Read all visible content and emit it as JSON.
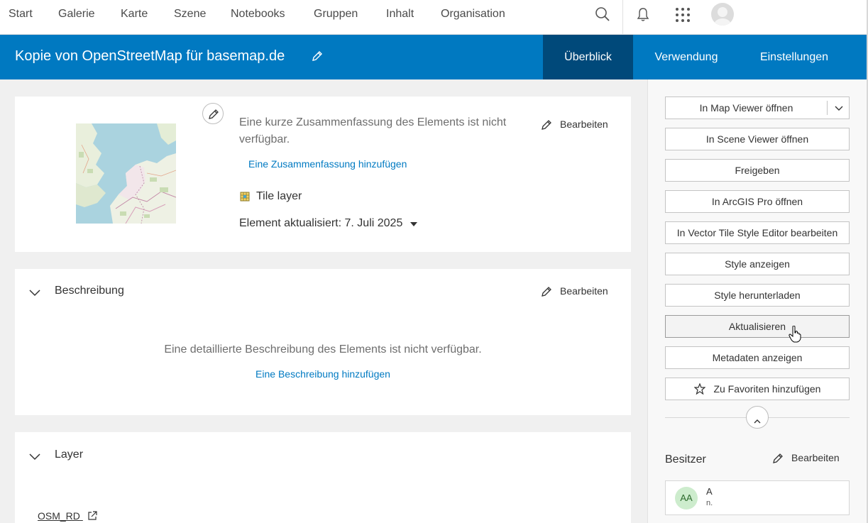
{
  "nav": {
    "items": [
      "Start",
      "Galerie",
      "Karte",
      "Szene",
      "Notebooks",
      "Gruppen",
      "Inhalt",
      "Organisation"
    ]
  },
  "header": {
    "title": "Kopie von OpenStreetMap für basemap.de",
    "tabs": [
      "Überblick",
      "Verwendung",
      "Einstellungen"
    ],
    "active_tab": "Überblick",
    "bg_color": "#0079c1",
    "active_color": "#00497a"
  },
  "summary": {
    "text": "Eine kurze Zusammenfassung des Elements ist nicht verfügbar.",
    "add_link": "Eine Zusammenfassung hinzufügen",
    "edit_label": "Bearbeiten",
    "type_label": "Tile layer",
    "updated_label": "Element aktualisiert: 7. Juli 2025"
  },
  "description": {
    "title": "Beschreibung",
    "edit_label": "Bearbeiten",
    "empty_text": "Eine detaillierte Beschreibung des Elements ist nicht verfügbar.",
    "add_link": "Eine Beschreibung hinzufügen"
  },
  "layers": {
    "title": "Layer",
    "items": [
      "OSM_RD"
    ]
  },
  "sidebar": {
    "buttons": [
      "In Map Viewer öffnen",
      "In Scene Viewer öffnen",
      "Freigeben",
      "In ArcGIS Pro öffnen",
      "In Vector Tile Style Editor bearbeiten",
      "Style anzeigen",
      "Style herunterladen",
      "Aktualisieren",
      "Metadaten anzeigen",
      "Zu Favoriten hinzufügen"
    ],
    "owner_title": "Besitzer",
    "owner_edit": "Bearbeiten",
    "owner_initials": "AA",
    "owner_name": "A",
    "owner_sub": "n."
  }
}
